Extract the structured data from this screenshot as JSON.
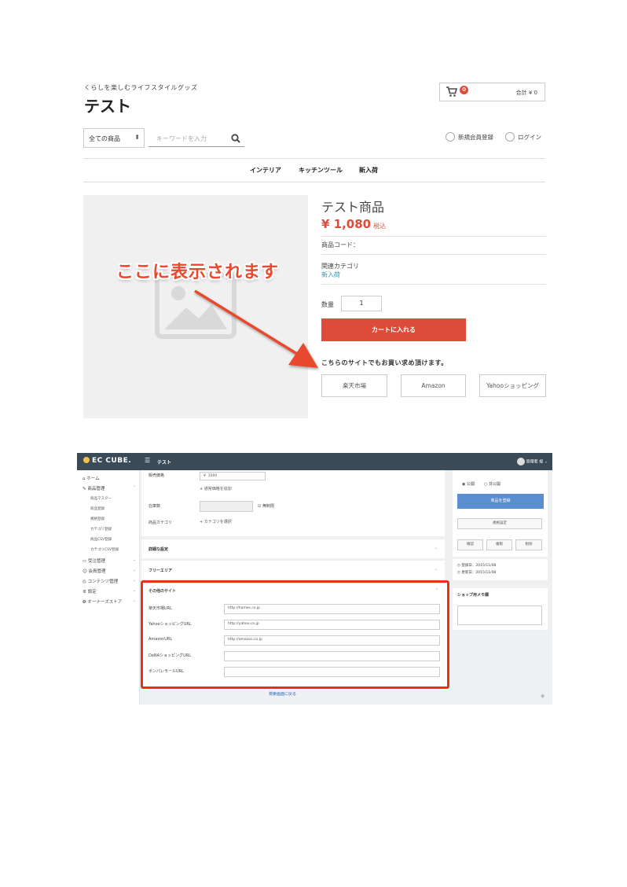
{
  "store": {
    "tagline": "くらしを楽しむライフスタイルグッズ",
    "title": "テスト",
    "cart": {
      "count": "0",
      "total": "合計 ¥ 0"
    },
    "category_select": "全ての商品",
    "search_placeholder": "キーワードを入力",
    "signup": "新規会員登録",
    "login": "ログイン",
    "nav": [
      "インテリア",
      "キッチンツール",
      "新入荷"
    ]
  },
  "product": {
    "name": "テスト商品",
    "price": "¥ 1,080",
    "tax": "税込",
    "code_label": "商品コード：",
    "related_label": "関連カテゴリ",
    "related_link": "新入荷",
    "qty_label": "数量",
    "qty_value": "1",
    "cart_button": "カートに入れる",
    "buy_elsewhere": "こちらのサイトでもお買い求め頂けます。",
    "sites": [
      "楽天市場",
      "Amazon",
      "Yahooショッピング"
    ]
  },
  "annotation": {
    "callout": "ここに表示されます"
  },
  "admin": {
    "logo": "EC CUBE.",
    "header_title": "テスト",
    "user": "管理者 様",
    "sidebar": [
      {
        "label": "ホーム",
        "sub": false
      },
      {
        "label": "商品管理",
        "sub": false
      },
      {
        "label": "商品マスター",
        "sub": true
      },
      {
        "label": "商品登録",
        "sub": true
      },
      {
        "label": "規格登録",
        "sub": true
      },
      {
        "label": "カテゴリ登録",
        "sub": true
      },
      {
        "label": "商品CSV登録",
        "sub": true
      },
      {
        "label": "カテゴリCSV登録",
        "sub": true
      },
      {
        "label": "受注管理",
        "sub": false
      },
      {
        "label": "会員管理",
        "sub": false
      },
      {
        "label": "コンテンツ管理",
        "sub": false
      },
      {
        "label": "設定",
        "sub": false
      },
      {
        "label": "オーナーズストア",
        "sub": false
      }
    ],
    "form": {
      "price_label": "販売価格",
      "price_currency": "¥",
      "price_value": "1000",
      "add_normal_price": "通常価格を追加",
      "stock_label": "在庫数",
      "unlimited": "無制限",
      "category_label": "商品カテゴリ",
      "select_category": "カテゴリを選択"
    },
    "sections": {
      "detail": "詳細な設定",
      "free": "フリーエリア",
      "other_sites": "その他のサイト"
    },
    "site_fields": [
      {
        "label": "楽天市場URL",
        "value": "http://hames.co.jp"
      },
      {
        "label": "YahooショッピングURL",
        "value": "http://yahoo.co.jp"
      },
      {
        "label": "AmazonURL",
        "value": "http://amazon.co.jp"
      },
      {
        "label": "DeNAショッピングURL",
        "value": ""
      },
      {
        "label": "ポンパレモールURL",
        "value": ""
      }
    ],
    "right": {
      "public": "公開",
      "private": "非公開",
      "register": "商品を登録",
      "spec": "規格設定",
      "confirm": "確認",
      "copy": "複製",
      "delete": "削除",
      "created": "登録日：2015/11/08",
      "updated": "更新日：2015/11/08",
      "memo_title": "ショップ用メモ欄"
    },
    "back_link": "検索画面に戻る"
  },
  "colors": {
    "accent": "#dd4b39",
    "admin_header": "#3a4a57",
    "highlight_box": "#e8311b",
    "admin_button": "#5a8ed0"
  }
}
